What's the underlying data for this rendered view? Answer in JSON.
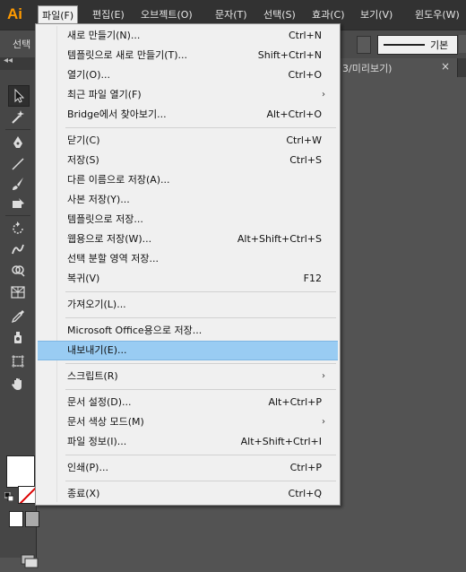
{
  "app": {
    "logo": "Ai"
  },
  "menubar": {
    "items": [
      "파일(F)",
      "편집(E)",
      "오브젝트(O)",
      "문자(T)",
      "선택(S)",
      "효과(C)",
      "보기(V)",
      "윈도우(W)"
    ]
  },
  "controlbar": {
    "select_label": "선택",
    "style_label": "기본"
  },
  "document_tab": {
    "label": "3/미리보기)",
    "close": "×"
  },
  "file_menu": {
    "items": [
      {
        "label": "새로 만들기(N)...",
        "shortcut": "Ctrl+N"
      },
      {
        "label": "템플릿으로 새로 만들기(T)...",
        "shortcut": "Shift+Ctrl+N"
      },
      {
        "label": "열기(O)...",
        "shortcut": "Ctrl+O"
      },
      {
        "label": "최근 파일 열기(F)",
        "shortcut": "",
        "submenu": true
      },
      {
        "label": "Bridge에서 찾아보기...",
        "shortcut": "Alt+Ctrl+O"
      },
      {
        "label": "닫기(C)",
        "shortcut": "Ctrl+W"
      },
      {
        "label": "저장(S)",
        "shortcut": "Ctrl+S"
      },
      {
        "label": "다른 이름으로 저장(A)...",
        "shortcut": ""
      },
      {
        "label": "사본 저장(Y)...",
        "shortcut": ""
      },
      {
        "label": "템플릿으로 저장...",
        "shortcut": ""
      },
      {
        "label": "웹용으로 저장(W)...",
        "shortcut": "Alt+Shift+Ctrl+S"
      },
      {
        "label": "선택 분할 영역 저장...",
        "shortcut": ""
      },
      {
        "label": "복귀(V)",
        "shortcut": "F12"
      },
      {
        "label": "가져오기(L)...",
        "shortcut": ""
      },
      {
        "label": "Microsoft Office용으로 저장...",
        "shortcut": ""
      },
      {
        "label": "내보내기(E)...",
        "shortcut": "",
        "highlighted": true
      },
      {
        "label": "스크립트(R)",
        "shortcut": "",
        "submenu": true
      },
      {
        "label": "문서 설정(D)...",
        "shortcut": "Alt+Ctrl+P"
      },
      {
        "label": "문서 색상 모드(M)",
        "shortcut": "",
        "submenu": true
      },
      {
        "label": "파일 정보(I)...",
        "shortcut": "Alt+Shift+Ctrl+I"
      },
      {
        "label": "인쇄(P)...",
        "shortcut": "Ctrl+P"
      },
      {
        "label": "종료(X)",
        "shortcut": "Ctrl+Q"
      }
    ],
    "submenu_arrow": "›"
  },
  "toolbar": {
    "collapse": "◂◂",
    "tools": [
      "selection-tool",
      "magic-wand-tool",
      "pen-tool",
      "line-tool",
      "brush-tool",
      "blob-brush-tool",
      "rotate-tool",
      "warp-tool",
      "shape-builder-tool",
      "perspective-grid-tool",
      "eyedropper-tool",
      "symbol-sprayer-tool",
      "artboard-tool",
      "hand-tool"
    ]
  },
  "colors": {
    "highlight": "#99ccf3",
    "logo": "#ff9a00",
    "menu_bg": "#f0f0f0"
  }
}
